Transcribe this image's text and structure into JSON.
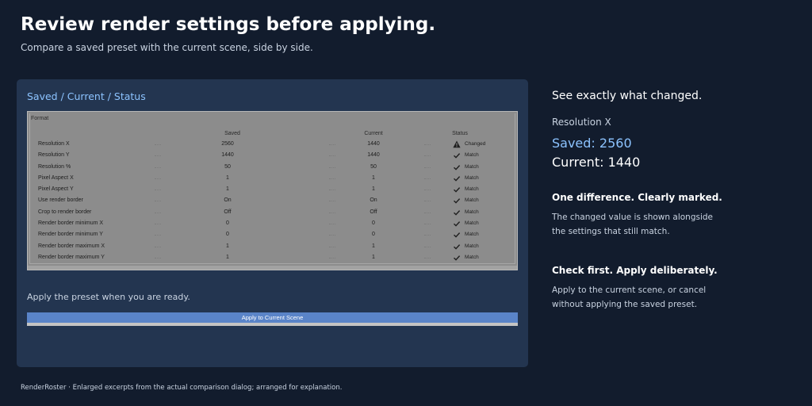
{
  "page": {
    "title": "Review render settings before applying.",
    "subtitle": "Compare a saved preset with the current scene, side by side."
  },
  "panel": {
    "heading": "Saved / Current / Status",
    "dialog": {
      "group_label": "Format",
      "columns": {
        "saved": "Saved",
        "current": "Current",
        "status": "Status"
      },
      "rows": [
        {
          "label": "Resolution X",
          "saved": "2560",
          "current": "1440",
          "status": "Changed",
          "status_icon": "warning-icon"
        },
        {
          "label": "Resolution Y",
          "saved": "1440",
          "current": "1440",
          "status": "Match",
          "status_icon": "check-icon"
        },
        {
          "label": "Resolution %",
          "saved": "50",
          "current": "50",
          "status": "Match",
          "status_icon": "check-icon"
        },
        {
          "label": "Pixel Aspect X",
          "saved": "1",
          "current": "1",
          "status": "Match",
          "status_icon": "check-icon"
        },
        {
          "label": "Pixel Aspect Y",
          "saved": "1",
          "current": "1",
          "status": "Match",
          "status_icon": "check-icon"
        },
        {
          "label": "Use render border",
          "saved": "On",
          "current": "On",
          "status": "Match",
          "status_icon": "check-icon"
        },
        {
          "label": "Crop to render border",
          "saved": "Off",
          "current": "Off",
          "status": "Match",
          "status_icon": "check-icon"
        },
        {
          "label": "Render border minimum X",
          "saved": "0",
          "current": "0",
          "status": "Match",
          "status_icon": "check-icon"
        },
        {
          "label": "Render border minimum Y",
          "saved": "0",
          "current": "0",
          "status": "Match",
          "status_icon": "check-icon"
        },
        {
          "label": "Render border maximum X",
          "saved": "1",
          "current": "1",
          "status": "Match",
          "status_icon": "check-icon"
        },
        {
          "label": "Render border maximum Y",
          "saved": "1",
          "current": "1",
          "status": "Match",
          "status_icon": "check-icon"
        }
      ]
    },
    "apply_caption": "Apply the preset when you are ready.",
    "apply_button": "Apply to Current Scene"
  },
  "side": {
    "heading": "See exactly what changed.",
    "setting_label": "Resolution X",
    "saved_line": "Saved: 2560",
    "current_line": "Current: 1440",
    "block1_title": "One difference. Clearly marked.",
    "block1_body": "The changed value is shown alongside the settings that still match.",
    "block2_title": "Check first. Apply deliberately.",
    "block2_body": "Apply to the current scene, or cancel without applying the saved preset."
  },
  "footer": "RenderRoster · Enlarged excerpts from the actual comparison dialog; arranged for explanation.",
  "colors": {
    "background": "#121c2d",
    "panel": "#233550",
    "accent": "#8cc3ff",
    "button": "#5a84c8",
    "dialog": "#8c8c8c"
  }
}
